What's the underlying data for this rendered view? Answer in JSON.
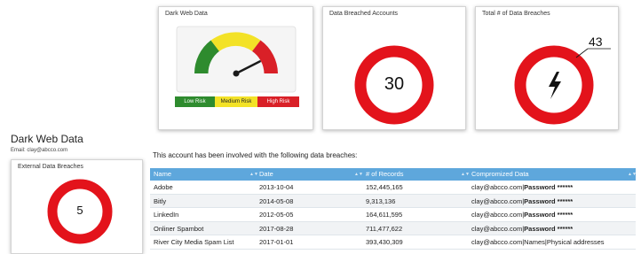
{
  "cards": {
    "dark_web": {
      "title": "Dark Web Data",
      "risk_low": "Low Risk",
      "risk_medium": "Medium Risk",
      "risk_high": "High Risk",
      "gauge_level": 0.85,
      "colors": {
        "low": "#2e8b2e",
        "medium": "#f3e227",
        "high": "#d92027"
      }
    },
    "accounts": {
      "title": "Data Breached Accounts",
      "value": "30"
    },
    "total": {
      "title": "Total # of Data Breaches",
      "value": "43",
      "icon": "lightning-bolt-icon"
    }
  },
  "section": {
    "title": "Dark Web Data",
    "email": "Email: clay@abcco.com"
  },
  "external": {
    "title": "External Data Breaches",
    "value": "5"
  },
  "table": {
    "intro": "This account has been involved with the following data breaches:",
    "header_color": "#5ea7dc",
    "ring_color": "#e3131b",
    "columns": [
      "Name",
      "Date",
      "# of Records",
      "Compromized Data"
    ],
    "rows": [
      {
        "name": "Adobe",
        "date": "2013-10-04",
        "records": "152,445,165",
        "email": "clay@abcco.com",
        "sep": "|",
        "data": "Password ******"
      },
      {
        "name": "Bitly",
        "date": "2014-05-08",
        "records": "9,313,136",
        "email": "clay@abcco.com",
        "sep": "|",
        "data": "Password ******"
      },
      {
        "name": "LinkedIn",
        "date": "2012-05-05",
        "records": "164,611,595",
        "email": "clay@abcco.com",
        "sep": "|",
        "data": "Password ******"
      },
      {
        "name": "Onliner Spambot",
        "date": "2017-08-28",
        "records": "711,477,622",
        "email": "clay@abcco.com",
        "sep": "|",
        "data": "Password ******"
      },
      {
        "name": "River City Media Spam List",
        "date": "2017-01-01",
        "records": "393,430,309",
        "email": "clay@abcco.com",
        "sep": "|",
        "data": "Names|Physical addresses"
      }
    ]
  }
}
